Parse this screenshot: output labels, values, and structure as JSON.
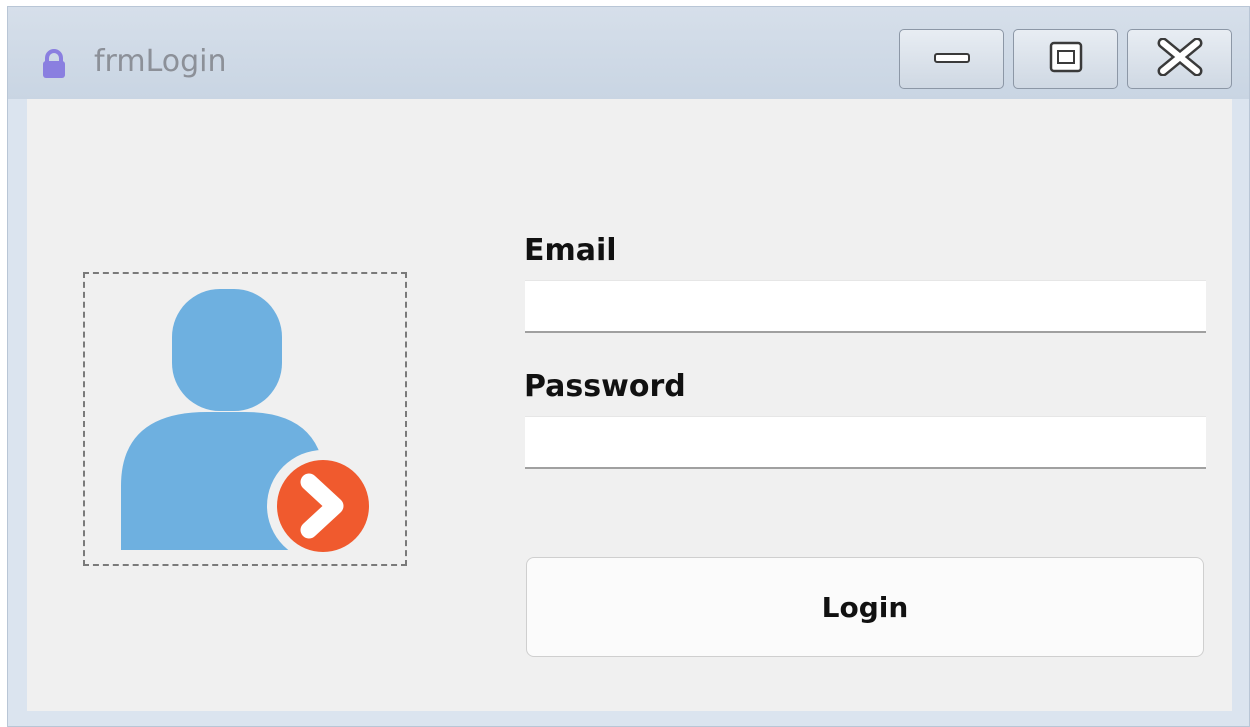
{
  "window": {
    "title": "frmLogin",
    "icon": "lock-icon",
    "controls": {
      "minimize": "minimize-icon",
      "maximize": "maximize-icon",
      "close": "close-icon"
    }
  },
  "form": {
    "picture": "user-login-icon",
    "email_label": "Email",
    "email_value": "",
    "password_label": "Password",
    "password_value": "",
    "login_label": "Login"
  },
  "colors": {
    "user_icon": "#6eb0e0",
    "arrow_badge": "#f05a2e",
    "lock_icon": "#8a7fe0"
  }
}
